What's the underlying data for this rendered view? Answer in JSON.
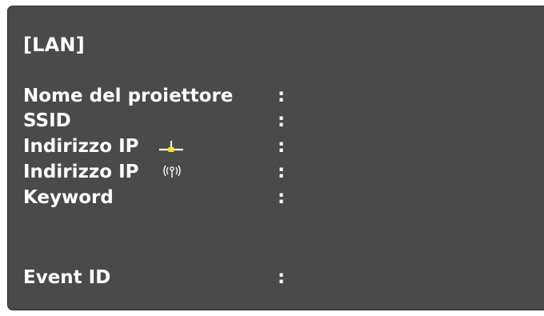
{
  "window": {
    "title": "[LAN]"
  },
  "info_rows": [
    {
      "label": "Nome del proiettore",
      "separator": ":",
      "value": ""
    },
    {
      "label": "SSID",
      "separator": ":",
      "value": ""
    },
    {
      "label": "Indirizzo IP",
      "icon": "wired-lan-icon",
      "separator": ":",
      "value": ""
    },
    {
      "label": "Indirizzo IP",
      "icon": "wireless-antenna-icon",
      "separator": ":",
      "value": ""
    },
    {
      "label": "Keyword",
      "separator": ":",
      "value": ""
    }
  ],
  "event": {
    "label": "Event ID",
    "separator": ":",
    "value": ""
  },
  "colors": {
    "panel_background": "#4a4a4a",
    "text": "#ffffff",
    "wired_icon_accent": "#ffe600"
  }
}
